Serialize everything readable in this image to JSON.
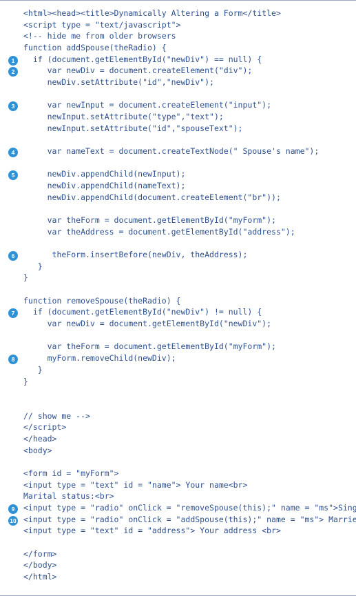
{
  "lines": [
    {
      "bullet": "",
      "text": "<html><head><title>Dynamically Altering a Form</title>"
    },
    {
      "bullet": "",
      "text": "<script type = \"text/javascript\">"
    },
    {
      "bullet": "",
      "text": "<!-- hide me from older browsers"
    },
    {
      "bullet": "",
      "text": "function addSpouse(theRadio) {"
    },
    {
      "bullet": "1",
      "text": "  if (document.getElementById(\"newDiv\") == null) {"
    },
    {
      "bullet": "2",
      "text": "     var newDiv = document.createElement(\"div\");"
    },
    {
      "bullet": "",
      "text": "     newDiv.setAttribute(\"id\",\"newDiv\");"
    },
    {
      "bullet": "",
      "text": ""
    },
    {
      "bullet": "3",
      "text": "     var newInput = document.createElement(\"input\");"
    },
    {
      "bullet": "",
      "text": "     newInput.setAttribute(\"type\",\"text\");"
    },
    {
      "bullet": "",
      "text": "     newInput.setAttribute(\"id\",\"spouseText\");"
    },
    {
      "bullet": "",
      "text": ""
    },
    {
      "bullet": "4",
      "text": "     var nameText = document.createTextNode(\" Spouse's name\");"
    },
    {
      "bullet": "",
      "text": ""
    },
    {
      "bullet": "5",
      "text": "     newDiv.appendChild(newInput);"
    },
    {
      "bullet": "",
      "text": "     newDiv.appendChild(nameText);"
    },
    {
      "bullet": "",
      "text": "     newDiv.appendChild(document.createElement(\"br\"));"
    },
    {
      "bullet": "",
      "text": ""
    },
    {
      "bullet": "",
      "text": "     var theForm = document.getElementById(\"myForm\");"
    },
    {
      "bullet": "",
      "text": "     var theAddress = document.getElementById(\"address\");"
    },
    {
      "bullet": "",
      "text": ""
    },
    {
      "bullet": "6",
      "text": "      theForm.insertBefore(newDiv, theAddress);"
    },
    {
      "bullet": "",
      "text": "   }"
    },
    {
      "bullet": "",
      "text": "}"
    },
    {
      "bullet": "",
      "text": ""
    },
    {
      "bullet": "",
      "text": "function removeSpouse(theRadio) {"
    },
    {
      "bullet": "7",
      "text": "  if (document.getElementById(\"newDiv\") != null) {"
    },
    {
      "bullet": "",
      "text": "     var newDiv = document.getElementById(\"newDiv\");"
    },
    {
      "bullet": "",
      "text": ""
    },
    {
      "bullet": "",
      "text": "     var theForm = document.getElementById(\"myForm\");"
    },
    {
      "bullet": "8",
      "text": "     myForm.removeChild(newDiv);"
    },
    {
      "bullet": "",
      "text": "   }"
    },
    {
      "bullet": "",
      "text": "}"
    },
    {
      "bullet": "",
      "text": ""
    },
    {
      "bullet": "",
      "text": ""
    },
    {
      "bullet": "",
      "text": "// show me -->"
    },
    {
      "bullet": "",
      "text": "</script>"
    },
    {
      "bullet": "",
      "text": "</head>"
    },
    {
      "bullet": "",
      "text": "<body>"
    },
    {
      "bullet": "",
      "text": ""
    },
    {
      "bullet": "",
      "text": "<form id = \"myForm\">"
    },
    {
      "bullet": "",
      "text": "<input type = \"text\" id = \"name\"> Your name<br>"
    },
    {
      "bullet": "",
      "text": "Marital status:<br>"
    },
    {
      "bullet": "9",
      "text": "<input type = \"radio\" onClick = \"removeSpouse(this);\" name = \"ms\">Single <br>"
    },
    {
      "bullet": "10",
      "text": "<input type = \"radio\" onClick = \"addSpouse(this);\" name = \"ms\"> Married<br>"
    },
    {
      "bullet": "",
      "text": "<input type = \"text\" id = \"address\"> Your address <br>"
    },
    {
      "bullet": "",
      "text": ""
    },
    {
      "bullet": "",
      "text": "</form>"
    },
    {
      "bullet": "",
      "text": "</body>"
    },
    {
      "bullet": "",
      "text": "</html>"
    }
  ]
}
